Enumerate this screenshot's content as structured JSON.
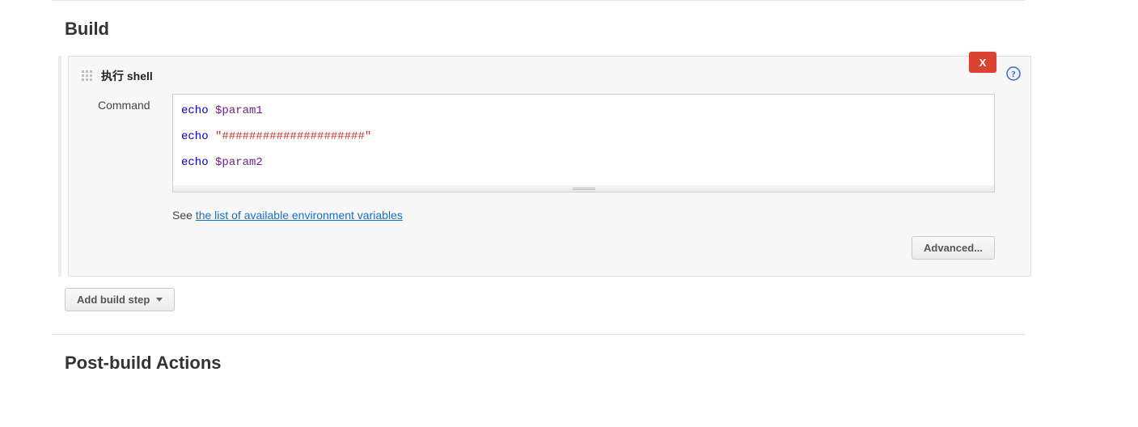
{
  "build": {
    "title": "Build",
    "step_title": "执行 shell",
    "delete_label": "X",
    "command_label": "Command",
    "command_tokens": [
      [
        [
          "kw",
          "echo"
        ],
        [
          "sp",
          " "
        ],
        [
          "var",
          "$param1"
        ]
      ],
      [
        [
          "kw",
          "echo"
        ],
        [
          "sp",
          " "
        ],
        [
          "str",
          "\"#####################\""
        ]
      ],
      [
        [
          "kw",
          "echo"
        ],
        [
          "sp",
          " "
        ],
        [
          "var",
          "$param2"
        ]
      ]
    ],
    "hint_prefix": "See ",
    "hint_link": "the list of available environment variables",
    "advanced_label": "Advanced...",
    "add_step_label": "Add build step"
  },
  "postbuild": {
    "title": "Post-build Actions"
  }
}
